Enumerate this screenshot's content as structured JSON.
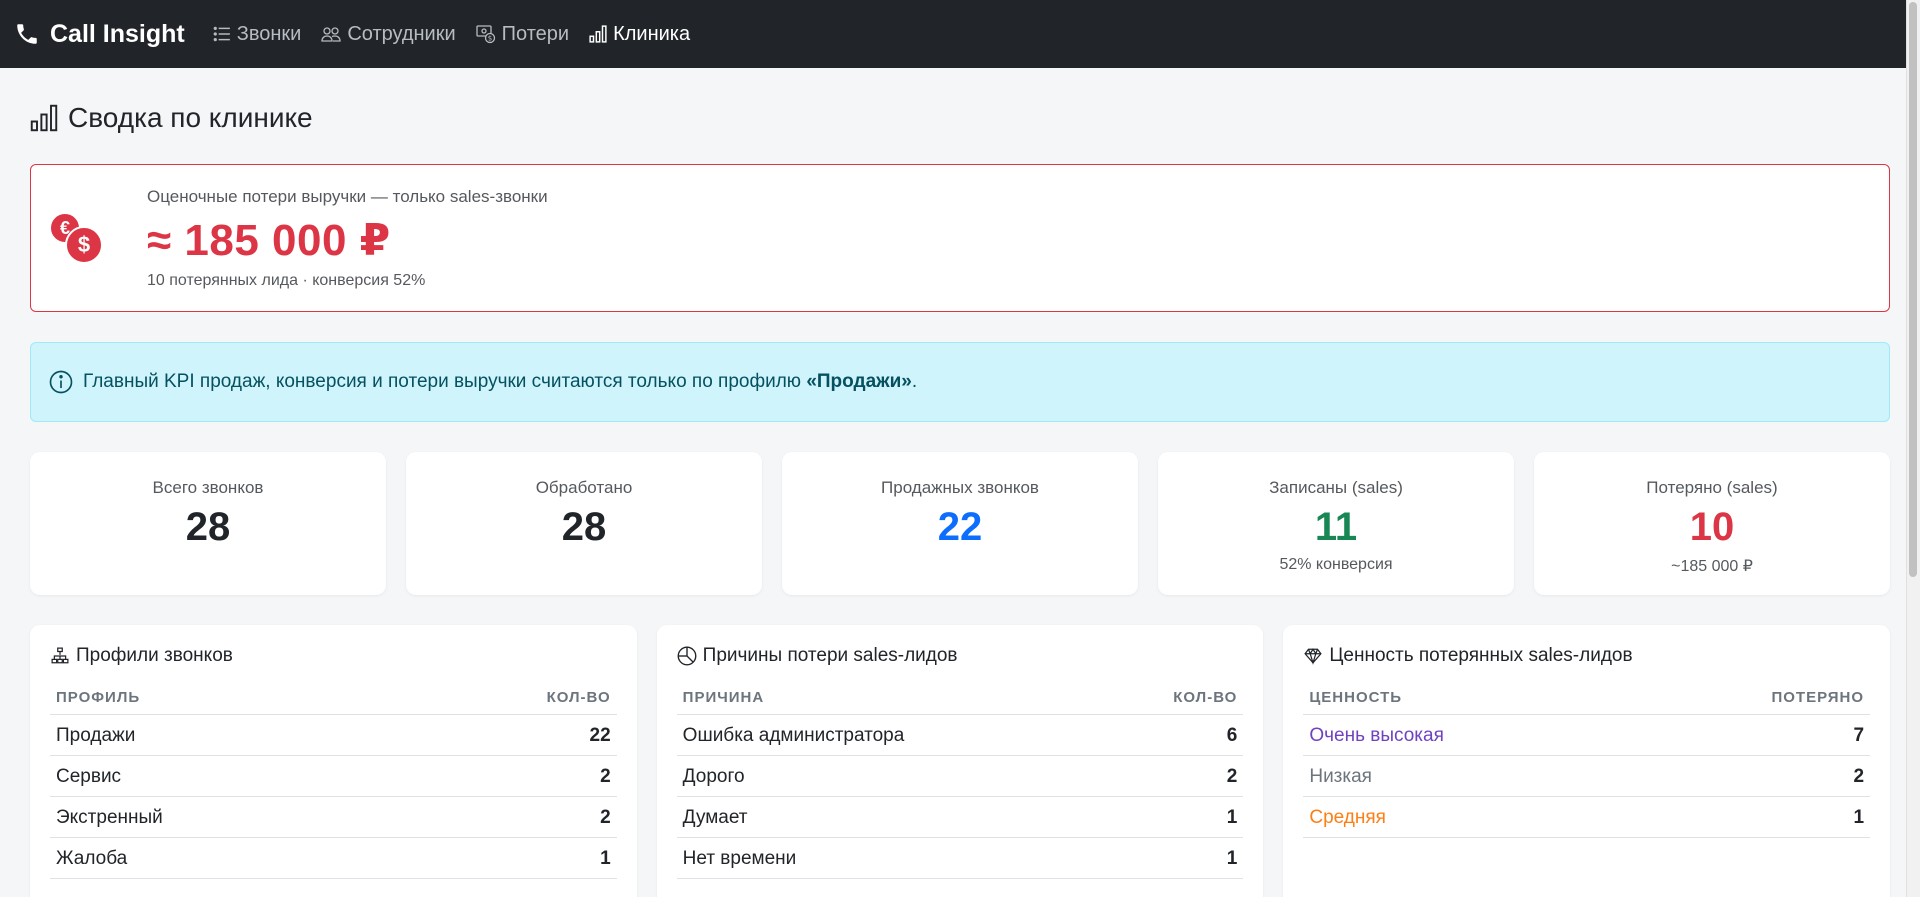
{
  "navbar": {
    "brand": "Call Insight",
    "items": [
      {
        "label": "Звонки",
        "icon": "list-icon"
      },
      {
        "label": "Сотрудники",
        "icon": "people-icon"
      },
      {
        "label": "Потери",
        "icon": "cash-loss-icon"
      },
      {
        "label": "Клиника",
        "icon": "bar-chart-icon",
        "active": true
      }
    ]
  },
  "page": {
    "title": "Сводка по клинике"
  },
  "loss": {
    "caption": "Оценочные потери выручки — только sales-звонки",
    "amount": "≈ 185 000 ₽",
    "subtitle": "10 потерянных лида · конверсия 52%",
    "accent": "#dc3545"
  },
  "info": {
    "text": "Главный KPI продаж, конверсия и потери выручки считаются только по профилю ",
    "bold": "«Продажи»",
    "tail": "."
  },
  "kpis": [
    {
      "label": "Всего звонков",
      "value": "28",
      "color": "#212529",
      "note": ""
    },
    {
      "label": "Обработано",
      "value": "28",
      "color": "#212529",
      "note": ""
    },
    {
      "label": "Продажных звонков",
      "value": "22",
      "color": "#0d6efd",
      "note": ""
    },
    {
      "label": "Записаны (sales)",
      "value": "11",
      "color": "#198754",
      "note": "52% конверсия"
    },
    {
      "label": "Потеряно (sales)",
      "value": "10",
      "color": "#dc3545",
      "note": "~185 000 ₽"
    }
  ],
  "profiles": {
    "title": "Профили звонков",
    "col1": "Профиль",
    "col2": "Кол-во",
    "rows": [
      {
        "name": "Продажи",
        "count": "22"
      },
      {
        "name": "Сервис",
        "count": "2"
      },
      {
        "name": "Экстренный",
        "count": "2"
      },
      {
        "name": "Жалоба",
        "count": "1"
      }
    ]
  },
  "reasons": {
    "title": "Причины потери sales-лидов",
    "col1": "Причина",
    "col2": "Кол-во",
    "rows": [
      {
        "name": "Ошибка администратора",
        "count": "6"
      },
      {
        "name": "Дорого",
        "count": "2"
      },
      {
        "name": "Думает",
        "count": "1"
      },
      {
        "name": "Нет времени",
        "count": "1"
      }
    ]
  },
  "values": {
    "title": "Ценность потерянных sales-лидов",
    "col1": "Ценность",
    "col2": "Потеряно",
    "rows": [
      {
        "name": "Очень высокая",
        "count": "7",
        "color": "#6f42c1"
      },
      {
        "name": "Низкая",
        "count": "2",
        "color": "#6c757d"
      },
      {
        "name": "Средняя",
        "count": "1",
        "color": "#fd7e14"
      }
    ]
  }
}
